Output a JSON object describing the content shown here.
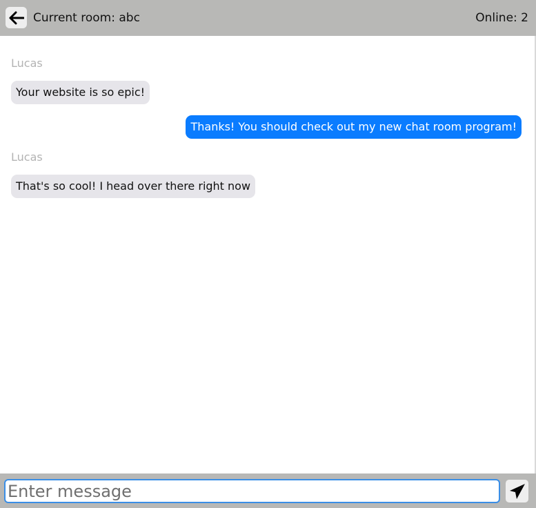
{
  "header": {
    "room_title": "Current room: abc",
    "online_count": "Online: 2",
    "back_icon": "arrow-left-icon",
    "background": "#b8b8b6"
  },
  "messages": [
    {
      "direction": "incoming",
      "sender": "Lucas",
      "text": "Your website is so epic!"
    },
    {
      "direction": "outgoing",
      "text": "Thanks! You should check out my new chat room program!"
    },
    {
      "direction": "incoming",
      "sender": "Lucas",
      "text": "That's so cool! I head over there right now"
    }
  ],
  "composer": {
    "placeholder": "Enter message",
    "value": "",
    "send_icon": "paper-plane-icon"
  },
  "colors": {
    "incoming_bubble": "#e6e5ea",
    "outgoing_bubble": "#0a7cff",
    "sender_name": "#b3b3b3",
    "input_border": "#3a8ee6"
  }
}
